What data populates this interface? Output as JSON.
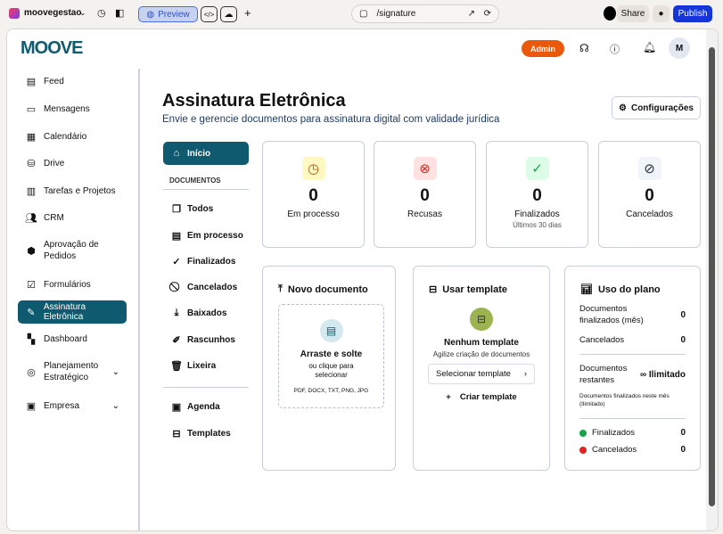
{
  "browser": {
    "project": "moovegestao",
    "preview": "Preview",
    "url": "/signature",
    "share": "Share",
    "publish": "Publish"
  },
  "header": {
    "logo": "MOOVE",
    "admin": "Admin",
    "avatar": "M"
  },
  "sidebar": {
    "items": [
      {
        "label": "Feed",
        "icon": "newspaper-icon"
      },
      {
        "label": "Mensagens",
        "icon": "message-icon"
      },
      {
        "label": "Calendário",
        "icon": "calendar-icon"
      },
      {
        "label": "Drive",
        "icon": "drive-icon"
      },
      {
        "label": "Tarefas e Projetos",
        "icon": "clipboard-icon"
      },
      {
        "label": "CRM",
        "icon": "users-icon"
      },
      {
        "label": "Aprovação de Pedidos",
        "icon": "package-icon"
      },
      {
        "label": "Formulários",
        "icon": "form-icon"
      },
      {
        "label": "Assinatura Eletrônica",
        "icon": "pen-icon"
      },
      {
        "label": "Dashboard",
        "icon": "dashboard-icon"
      },
      {
        "label": "Planejamento Estratégico",
        "icon": "target-icon"
      },
      {
        "label": "Empresa",
        "icon": "building-icon"
      }
    ]
  },
  "page": {
    "title": "Assinatura Eletrônica",
    "subtitle": "Envie e gerencie documentos para assinatura digital com validade jurídica",
    "settings": "Configurações"
  },
  "nav": {
    "home": "Início",
    "section": "DOCUMENTOS",
    "items": [
      "Todos",
      "Em processo",
      "Finalizados",
      "Cancelados",
      "Baixados",
      "Rascunhos",
      "Lixeira"
    ],
    "extra": [
      "Agenda",
      "Templates"
    ]
  },
  "stats": [
    {
      "value": "0",
      "label": "Em processo",
      "sub": "",
      "color": "#b45309",
      "bg": "#fef9c3"
    },
    {
      "value": "0",
      "label": "Recusas",
      "sub": "",
      "color": "#dc2626",
      "bg": "#fee2e2"
    },
    {
      "value": "0",
      "label": "Finalizados",
      "sub": "Últimos 30 dias",
      "color": "#16a34a",
      "bg": "#dcfce7"
    },
    {
      "value": "0",
      "label": "Cancelados",
      "sub": "",
      "color": "#1f2937",
      "bg": "#f1f5f9"
    }
  ],
  "new_doc": {
    "title": "Novo documento",
    "drop": "Arraste e solte",
    "hint": "ou clique para selecionar",
    "formats": "PDF, DOCX, TXT, PNG, JPG"
  },
  "template": {
    "title": "Usar template",
    "empty": "Nenhum template",
    "hint": "Agilize criação de documentos",
    "select": "Selecionar template",
    "create": "Criar template"
  },
  "plan": {
    "title": "Uso do plano",
    "finalized_label": "Documentos finalizados (mês)",
    "finalized": "0",
    "canceled_label": "Cancelados",
    "canceled": "0",
    "remaining_label": "Documentos restantes",
    "remaining": "∞ Ilimitado",
    "note": "Documentos finalizados neste mês (Ilimitado)",
    "legend": [
      {
        "label": "Finalizados",
        "value": "0",
        "color": "#16a34a"
      },
      {
        "label": "Cancelados",
        "value": "0",
        "color": "#dc2626"
      }
    ]
  }
}
